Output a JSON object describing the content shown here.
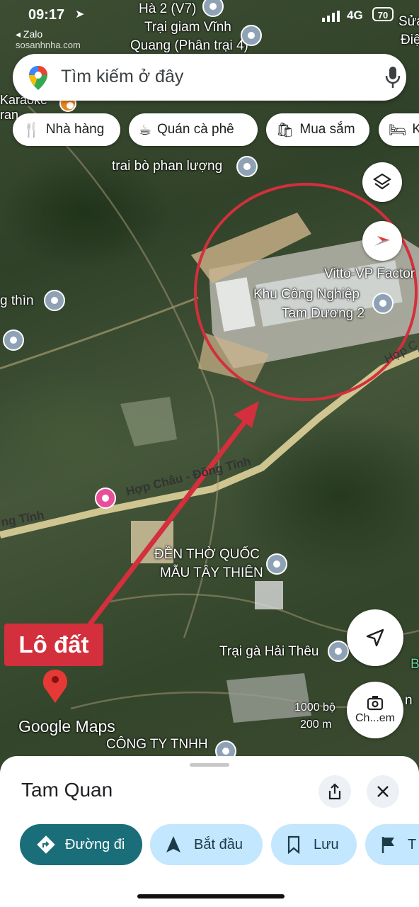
{
  "status": {
    "time": "09:17",
    "back_app": "Zalo",
    "network": "4G",
    "battery": "70",
    "watermark": "sosanhnha.com"
  },
  "search": {
    "placeholder": "Tìm kiếm ở đây"
  },
  "chips": [
    {
      "icon": "restaurant-icon",
      "label": "Nhà hàng"
    },
    {
      "icon": "cafe-icon",
      "label": "Quán cà phê"
    },
    {
      "icon": "shopping-icon",
      "label": "Mua sắm"
    },
    {
      "icon": "hotel-icon",
      "label": "K"
    }
  ],
  "map_labels": {
    "top1": "Hà 2 (V7)",
    "top2": "Trại giam Vĩnh",
    "top3": "Quang (Phân trại 4)",
    "top_right1": "Sửa",
    "top_right2": "Điệ",
    "karaoke": "Karaoke",
    "karaoke2": "ran",
    "cow_farm": "trai bò phan lượng",
    "factory": "Vitto-VP Factor",
    "industrial1": "Khu Công Nghiệp",
    "industrial2": "Tam Dương 2",
    "hop_c": "Hợp C",
    "left_name": "g thìn",
    "road": "Hợp Châu - Đồng Tĩnh",
    "road_left": "ng Tĩnh",
    "temple1": "ĐỀN THỜ QUỐC",
    "temple2": "MẪU TÂY THIÊN",
    "chicken_farm": "Trại gà Hải Thêu",
    "company": "CÔNG TY TNHH",
    "scale1": "1000 bộ",
    "scale2": "200 m",
    "google_maps": "Google Maps",
    "annotation": "Lô đất",
    "right_b": "B",
    "right_n": "n"
  },
  "screenshot_btn": {
    "label": "Ch...em"
  },
  "place": {
    "title": "Tam Quan"
  },
  "actions": [
    {
      "label": "Đường đi",
      "primary": true
    },
    {
      "label": "Bắt đầu",
      "primary": false
    },
    {
      "label": "Lưu",
      "primary": false
    },
    {
      "label": "T",
      "primary": false
    }
  ],
  "colors": {
    "primary": "#1a6e7a",
    "secondary_bg": "#c2e7ff",
    "annotation_red": "#d32f3c"
  }
}
